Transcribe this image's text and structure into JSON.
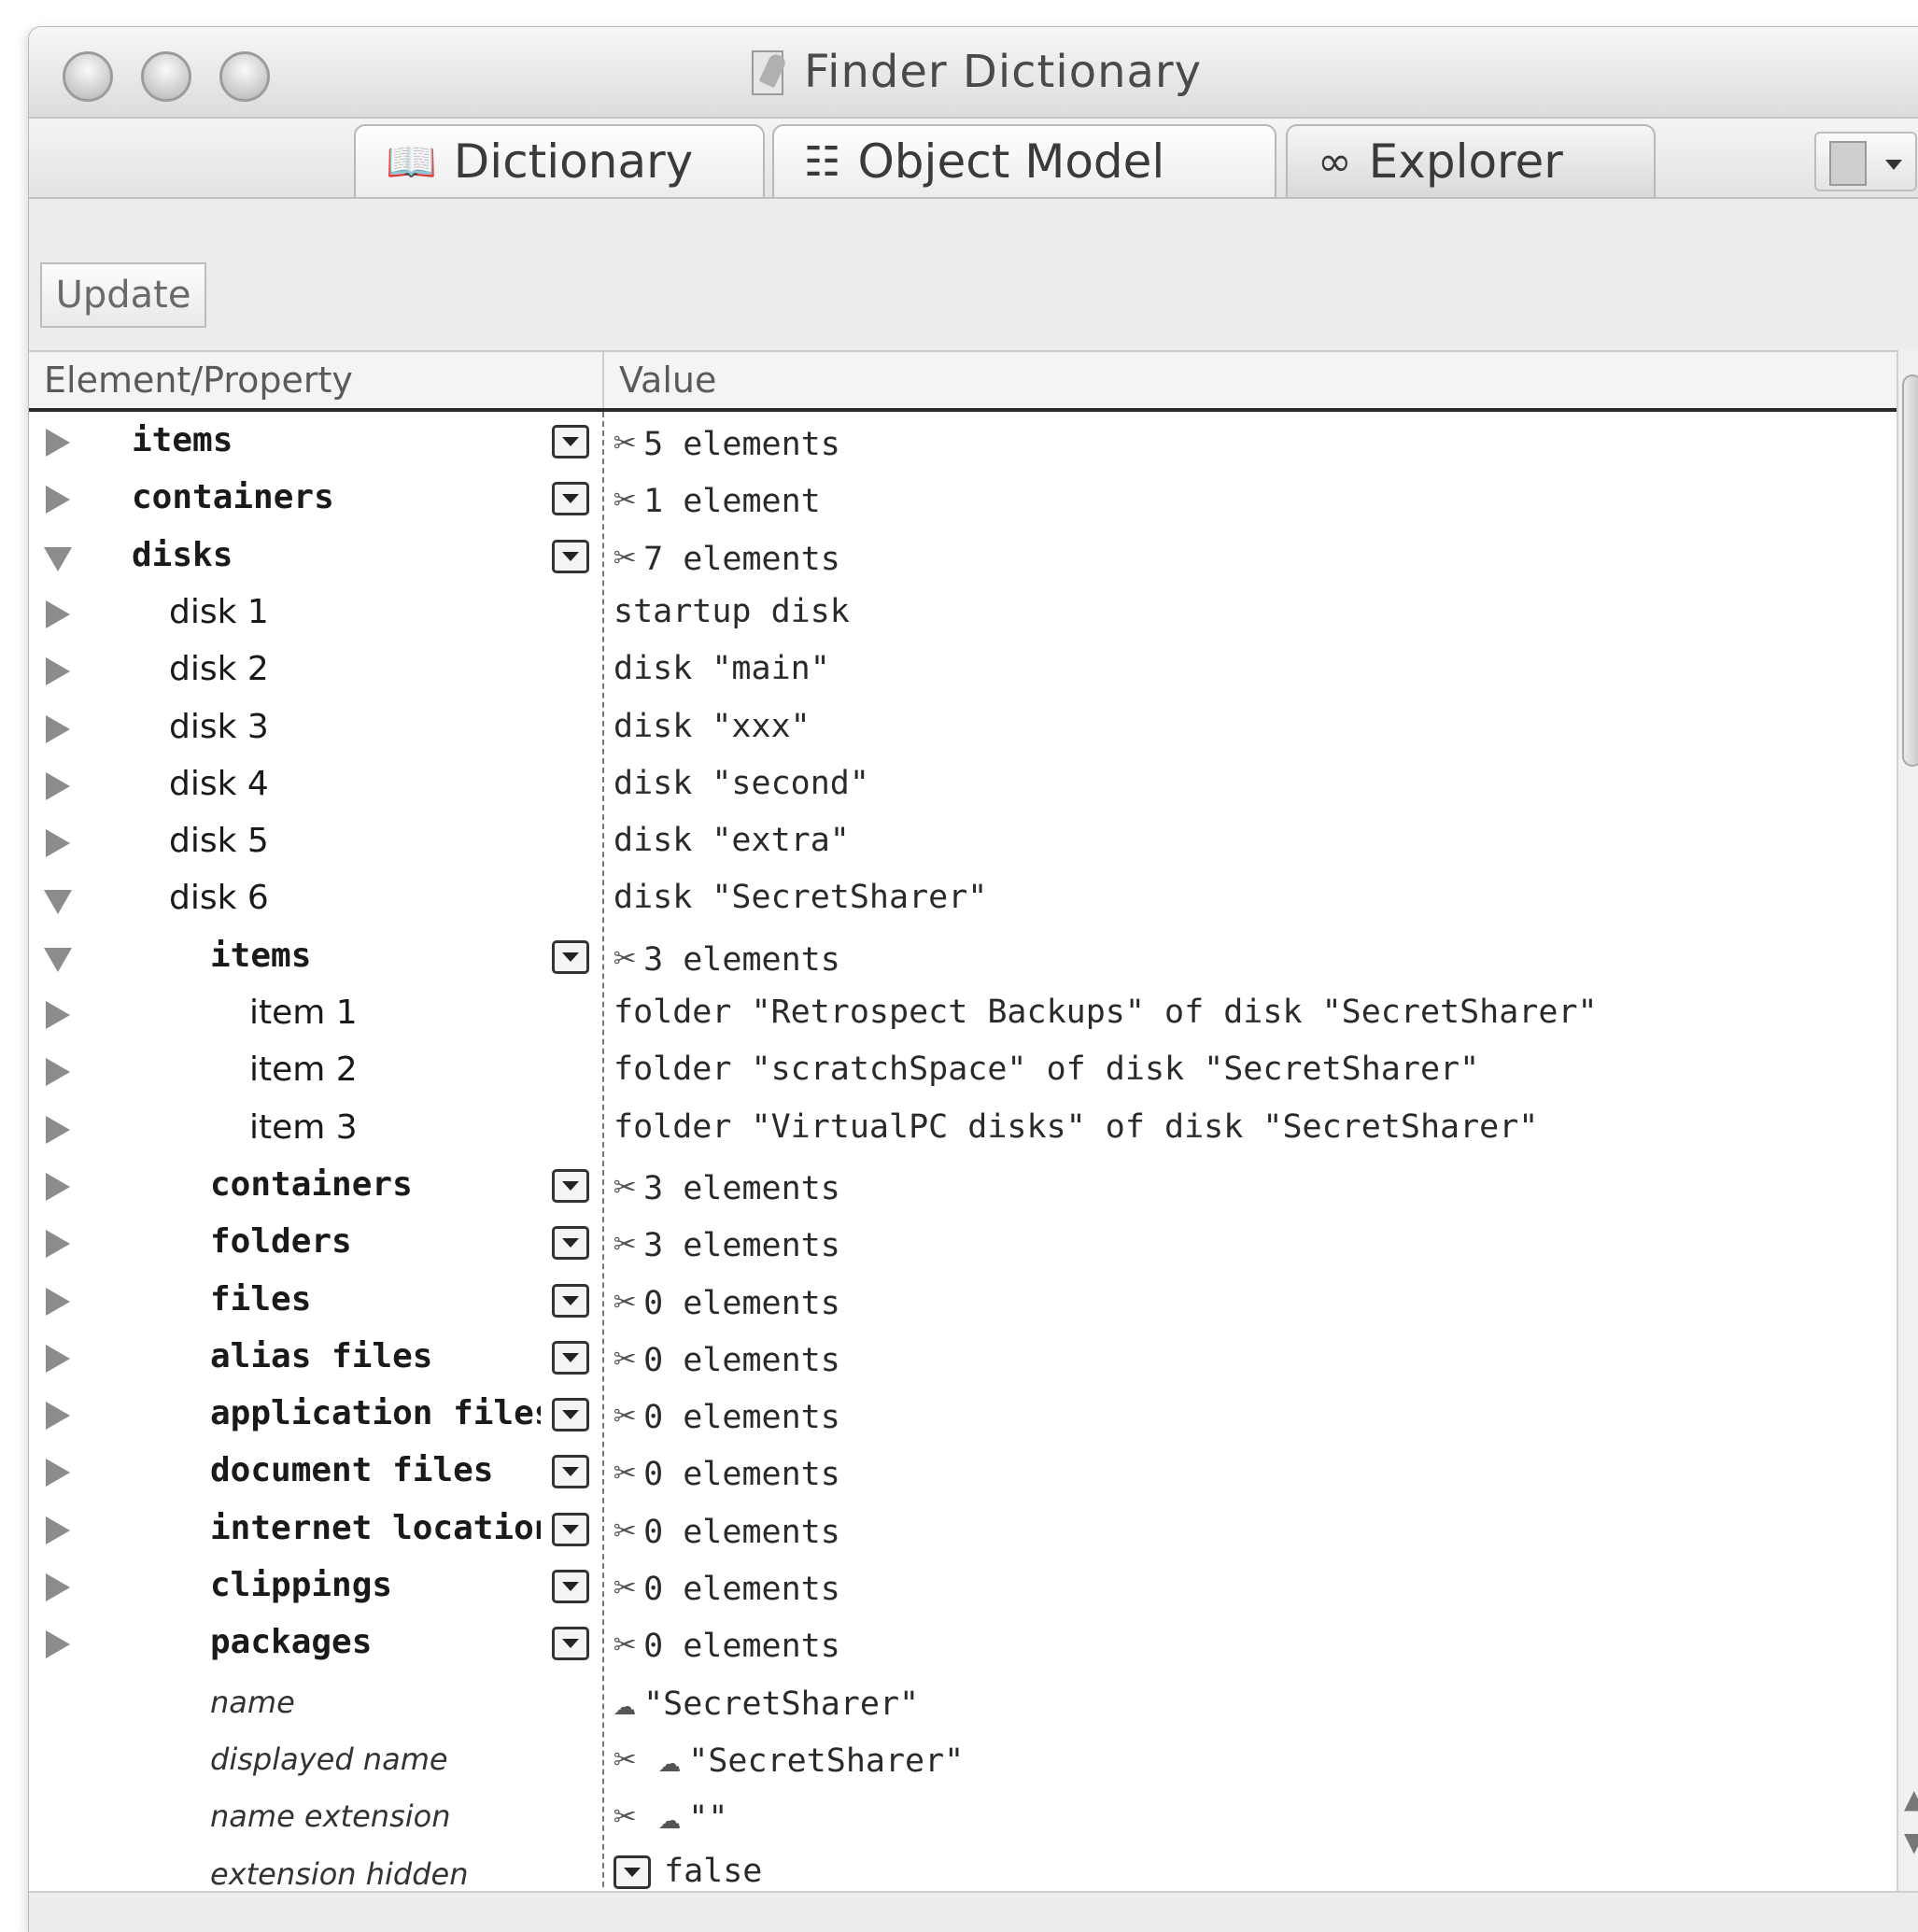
{
  "window": {
    "title": "Finder Dictionary"
  },
  "tabs": [
    {
      "label": "Dictionary",
      "icon": "dictionary-icon"
    },
    {
      "label": "Object Model",
      "icon": "object-model-icon"
    },
    {
      "label": "Explorer",
      "icon": "glasses-icon"
    }
  ],
  "toolbar": {
    "update_label": "Update"
  },
  "columns": {
    "element_property": "Element/Property",
    "value": "Value"
  },
  "rows": [
    {
      "label": "items",
      "value": "5 elements",
      "style": "bold",
      "indent": 0,
      "toggle": "collapsed",
      "popup": true,
      "value_icon": "tool-icon"
    },
    {
      "label": "containers",
      "value": "1 element",
      "style": "bold",
      "indent": 0,
      "toggle": "collapsed",
      "popup": true,
      "value_icon": "tool-icon"
    },
    {
      "label": "disks",
      "value": "7 elements",
      "style": "bold",
      "indent": 0,
      "toggle": "expanded",
      "popup": true,
      "value_icon": "tool-icon"
    },
    {
      "label": "disk 1",
      "value": "startup disk",
      "style": "plain",
      "indent": 1,
      "toggle": "collapsed",
      "popup": false
    },
    {
      "label": "disk 2",
      "value": "disk \"main\"",
      "style": "plain",
      "indent": 1,
      "toggle": "collapsed",
      "popup": false
    },
    {
      "label": "disk 3",
      "value": "disk \"xxx\"",
      "style": "plain",
      "indent": 1,
      "toggle": "collapsed",
      "popup": false
    },
    {
      "label": "disk 4",
      "value": "disk \"second\"",
      "style": "plain",
      "indent": 1,
      "toggle": "collapsed",
      "popup": false
    },
    {
      "label": "disk 5",
      "value": "disk \"extra\"",
      "style": "plain",
      "indent": 1,
      "toggle": "collapsed",
      "popup": false
    },
    {
      "label": "disk 6",
      "value": "disk \"SecretSharer\"",
      "style": "plain",
      "indent": 1,
      "toggle": "expanded",
      "popup": false
    },
    {
      "label": "items",
      "value": "3 elements",
      "style": "bold",
      "indent": 2,
      "toggle": "expanded",
      "popup": true,
      "value_icon": "tool-icon"
    },
    {
      "label": "item 1",
      "value": "folder \"Retrospect Backups\" of disk \"SecretSharer\"",
      "style": "plain",
      "indent": 3,
      "toggle": "collapsed",
      "popup": false
    },
    {
      "label": "item 2",
      "value": "folder \"scratchSpace\" of disk \"SecretSharer\"",
      "style": "plain",
      "indent": 3,
      "toggle": "collapsed",
      "popup": false
    },
    {
      "label": "item 3",
      "value": "folder \"VirtualPC disks\" of disk \"SecretSharer\"",
      "style": "plain",
      "indent": 3,
      "toggle": "collapsed",
      "popup": false
    },
    {
      "label": "containers",
      "value": "3 elements",
      "style": "bold",
      "indent": 2,
      "toggle": "collapsed",
      "popup": true,
      "value_icon": "tool-icon"
    },
    {
      "label": "folders",
      "value": "3 elements",
      "style": "bold",
      "indent": 2,
      "toggle": "collapsed",
      "popup": true,
      "value_icon": "tool-icon"
    },
    {
      "label": "files",
      "value": "0 elements",
      "style": "bold",
      "indent": 2,
      "toggle": "collapsed",
      "popup": true,
      "value_icon": "tool-icon"
    },
    {
      "label": "alias files",
      "value": "0 elements",
      "style": "bold",
      "indent": 2,
      "toggle": "collapsed",
      "popup": true,
      "value_icon": "tool-icon"
    },
    {
      "label": "application files",
      "value": "0 elements",
      "style": "bold",
      "indent": 2,
      "toggle": "collapsed",
      "popup": true,
      "value_icon": "tool-icon"
    },
    {
      "label": "document files",
      "value": "0 elements",
      "style": "bold",
      "indent": 2,
      "toggle": "collapsed",
      "popup": true,
      "value_icon": "tool-icon"
    },
    {
      "label": "internet location fi...",
      "value": "0 elements",
      "style": "bold",
      "indent": 2,
      "toggle": "collapsed",
      "popup": true,
      "value_icon": "tool-icon"
    },
    {
      "label": "clippings",
      "value": "0 elements",
      "style": "bold",
      "indent": 2,
      "toggle": "collapsed",
      "popup": true,
      "value_icon": "tool-icon"
    },
    {
      "label": "packages",
      "value": "0 elements",
      "style": "bold",
      "indent": 2,
      "toggle": "collapsed",
      "popup": true,
      "value_icon": "tool-icon"
    },
    {
      "label": "name",
      "value": "\"SecretSharer\"",
      "style": "italic",
      "indent": 2,
      "toggle": "none",
      "popup": false,
      "value_icon": "text-bubble-icon"
    },
    {
      "label": "displayed name",
      "value": "\"SecretSharer\"",
      "style": "italic",
      "indent": 2,
      "toggle": "none",
      "popup": false,
      "value_icon": "tool-text-icon"
    },
    {
      "label": "name extension",
      "value": "\"\"",
      "style": "italic",
      "indent": 2,
      "toggle": "none",
      "popup": false,
      "value_icon": "tool-text-icon"
    },
    {
      "label": "extension hidden",
      "value": "false",
      "style": "italic",
      "indent": 2,
      "toggle": "none",
      "popup": false,
      "value_icon": "popup-icon"
    }
  ]
}
